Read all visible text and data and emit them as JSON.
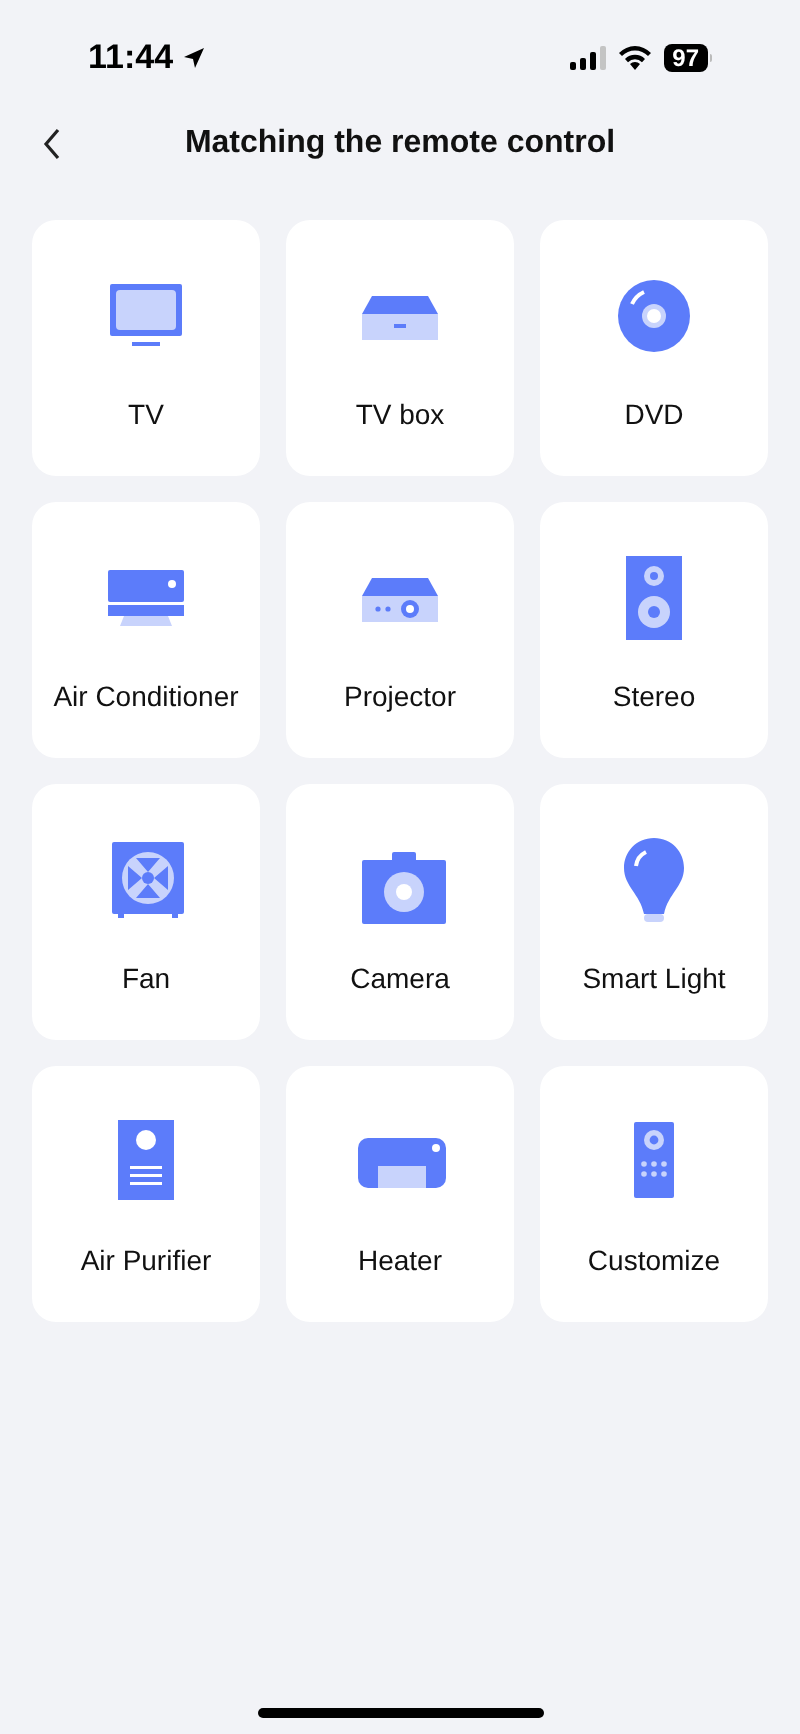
{
  "status_bar": {
    "time": "11:44",
    "battery": "97"
  },
  "header": {
    "title": "Matching the remote control"
  },
  "devices": [
    {
      "kind": "tv",
      "label": "TV"
    },
    {
      "kind": "tvbox",
      "label": "TV box"
    },
    {
      "kind": "dvd",
      "label": "DVD"
    },
    {
      "kind": "ac",
      "label": "Air Conditioner"
    },
    {
      "kind": "projector",
      "label": "Projector"
    },
    {
      "kind": "stereo",
      "label": "Stereo"
    },
    {
      "kind": "fan",
      "label": "Fan"
    },
    {
      "kind": "camera",
      "label": "Camera"
    },
    {
      "kind": "light",
      "label": "Smart Light"
    },
    {
      "kind": "purifier",
      "label": "Air Purifier"
    },
    {
      "kind": "heater",
      "label": "Heater"
    },
    {
      "kind": "remote",
      "label": "Customize"
    }
  ]
}
